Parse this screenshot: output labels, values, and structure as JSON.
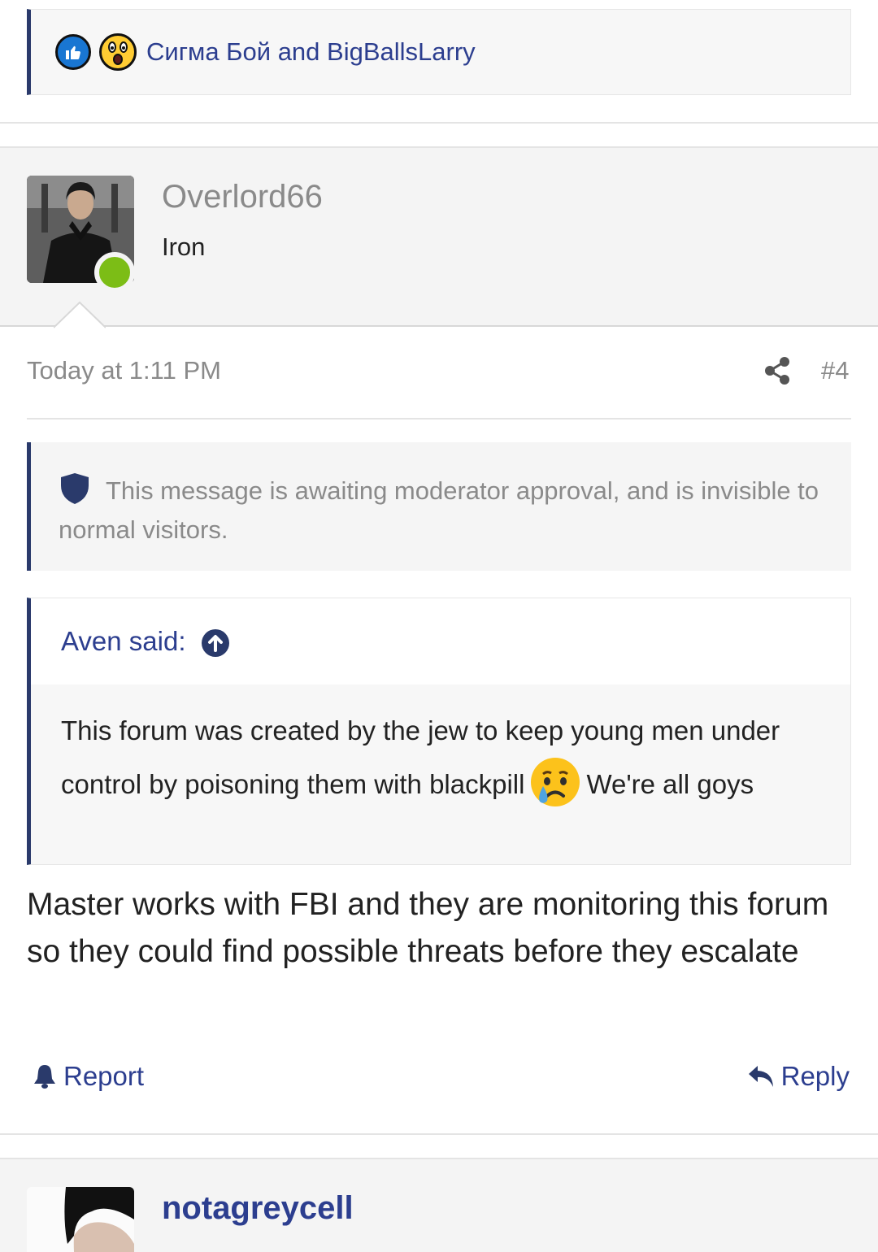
{
  "reactions": {
    "icons": [
      "like-icon",
      "wow-icon"
    ],
    "names_text": "Сигма Бой and BigBallsLarry"
  },
  "post": {
    "author": "Overlord66",
    "user_title": "Iron",
    "online": true,
    "date": "Today at 1:11 PM",
    "number": "#4",
    "moderation_notice": "This message is awaiting moderator approval, and is invisible to normal visitors.",
    "quote": {
      "author_label": "Aven said:",
      "text_before_emoji": "This forum was created by the jew to keep young men under control by poisoning them with blackpill",
      "emoji": "crying-face-emoji",
      "text_after_emoji": "We're all goys"
    },
    "body": "Master works with FBI and they are monitoring this forum so they could find possible threats before they escalate",
    "actions": {
      "report_label": "Report",
      "reply_label": "Reply"
    }
  },
  "next_post": {
    "author": "notagreycell"
  },
  "colors": {
    "link": "#2c3e8f",
    "accent_border": "#2a3a6b",
    "online": "#7cbd16",
    "muted_text": "#8a8a8a"
  }
}
